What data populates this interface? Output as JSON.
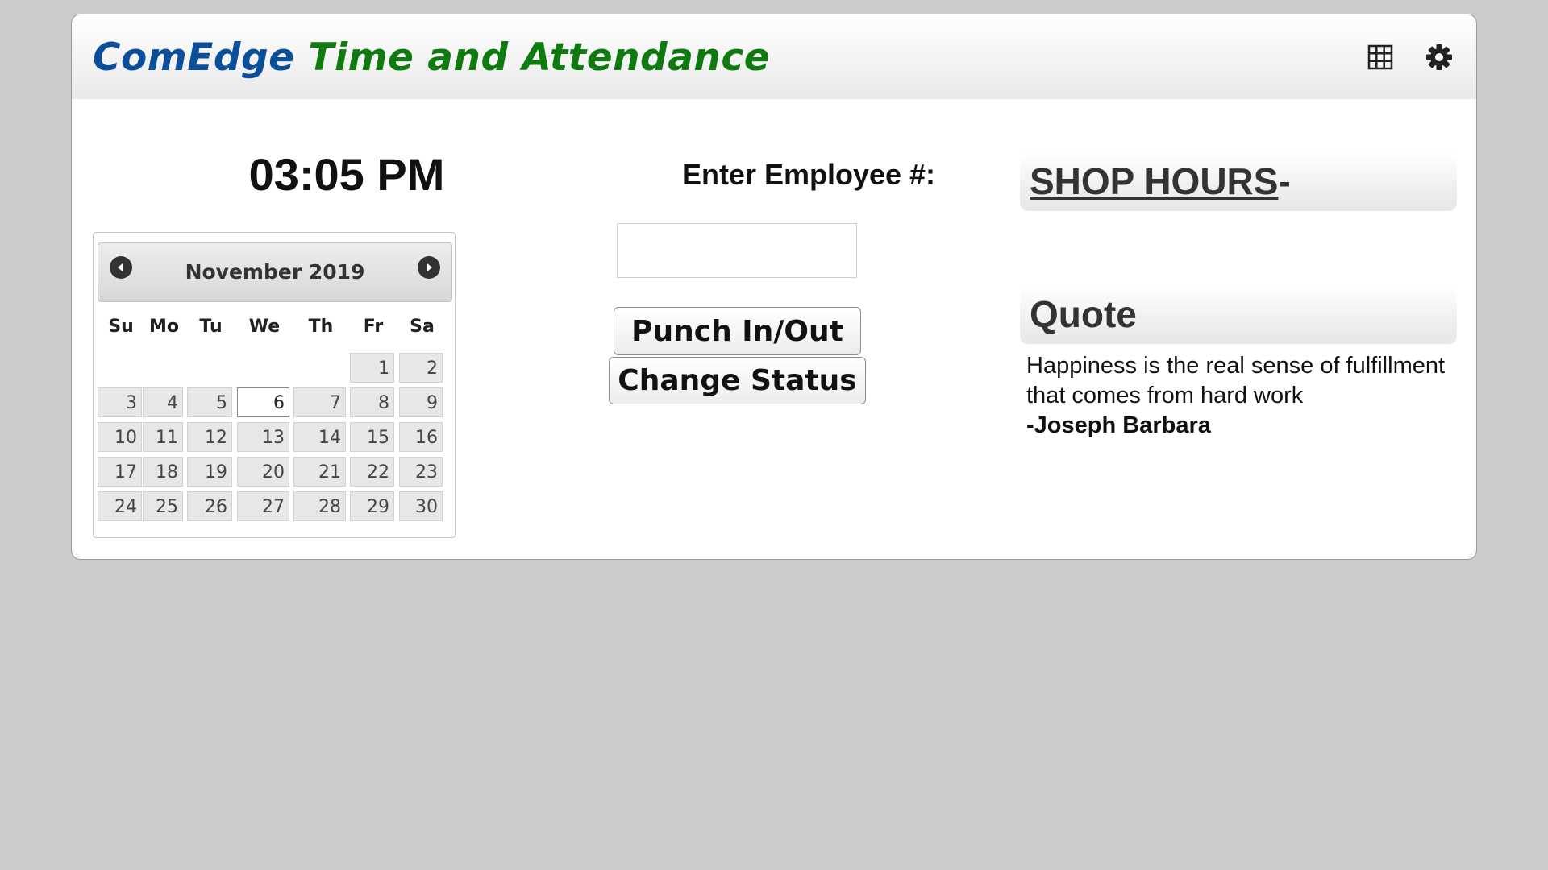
{
  "header": {
    "brand_part1": "ComEdge",
    "brand_part2": "Time and Attendance",
    "icons": [
      "grid-icon",
      "gear-icon"
    ]
  },
  "clock": {
    "time": "03:05 PM"
  },
  "calendar": {
    "month_label": "November 2019",
    "weekdays": [
      "Su",
      "Mo",
      "Tu",
      "We",
      "Th",
      "Fr",
      "Sa"
    ],
    "today": 6,
    "days": [
      [
        "",
        "",
        "",
        "",
        "",
        "1",
        "2"
      ],
      [
        "3",
        "4",
        "5",
        "6",
        "7",
        "8",
        "9"
      ],
      [
        "10",
        "11",
        "12",
        "13",
        "14",
        "15",
        "16"
      ],
      [
        "17",
        "18",
        "19",
        "20",
        "21",
        "22",
        "23"
      ],
      [
        "24",
        "25",
        "26",
        "27",
        "28",
        "29",
        "30"
      ]
    ]
  },
  "punch": {
    "label": "Enter Employee #:",
    "input_value": "",
    "punch_button": "Punch In/Out",
    "status_button": "Change Status"
  },
  "shop_hours": {
    "title": "SHOP HOURS",
    "suffix": "-"
  },
  "quote": {
    "title": "Quote",
    "text": "Happiness is the real sense of fulfillment that comes from hard work",
    "author": "-Joseph Barbara"
  },
  "colors": {
    "brand_blue": "#0b4f9a",
    "brand_green": "#0f7a0f",
    "page_bg": "#cccccc"
  }
}
